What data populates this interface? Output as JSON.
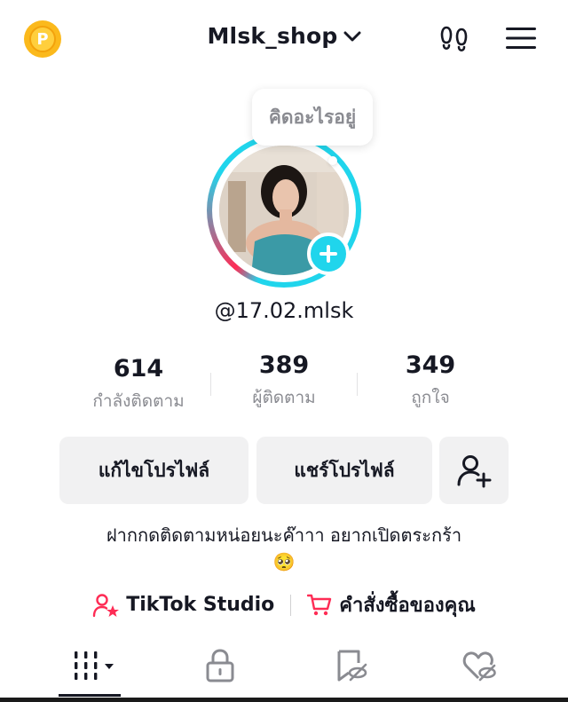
{
  "header": {
    "coin_letter": "P",
    "username": "Mlsk_shop"
  },
  "profile": {
    "note_bubble": "คิดอะไรอยู่",
    "handle": "@17.02.mlsk"
  },
  "stats": [
    {
      "value": "614",
      "label": "กำลังติดตาม"
    },
    {
      "value": "389",
      "label": "ผู้ติดตาม"
    },
    {
      "value": "349",
      "label": "ถูกใจ"
    }
  ],
  "actions": {
    "edit_profile": "แก้ไขโปรไฟล์",
    "share_profile": "แชร์โปรไฟล์"
  },
  "bio": {
    "line1": "ฝากกดติดตามหน่อยนะค๊าาา อยากเปิดตระกร้า",
    "emoji": "🥺"
  },
  "links": {
    "studio": "TikTok Studio",
    "orders": "คำสั่งซื้อของคุณ"
  },
  "colors": {
    "accent_cyan": "#20d5ec",
    "accent_red": "#fe2c55",
    "coin": "#fbb91c"
  }
}
